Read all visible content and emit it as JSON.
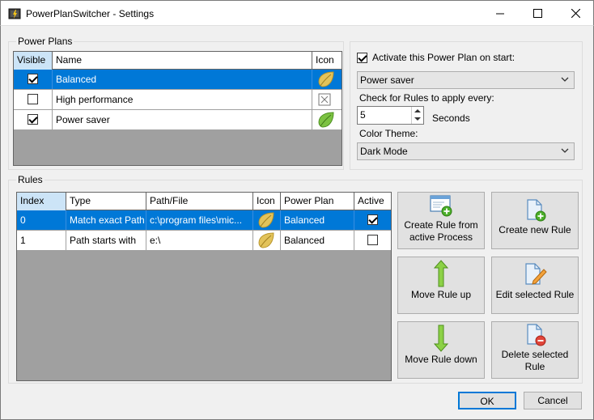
{
  "window": {
    "title": "PowerPlanSwitcher - Settings"
  },
  "power_plans": {
    "group_title": "Power Plans",
    "columns": [
      "Visible",
      "Name",
      "Icon"
    ],
    "rows": [
      {
        "visible": true,
        "name": "Balanced",
        "icon": "leaf-gold-icon",
        "selected": true
      },
      {
        "visible": false,
        "name": "High performance",
        "icon": "box-x-icon",
        "selected": false
      },
      {
        "visible": true,
        "name": "Power saver",
        "icon": "leaf-green-icon",
        "selected": false
      }
    ]
  },
  "plan_settings": {
    "activate_label": "Activate this Power Plan on start:",
    "activate_checked": true,
    "plan_select": "Power saver",
    "interval_label": "Check for Rules to apply every:",
    "interval_value": "5",
    "interval_unit": "Seconds",
    "theme_label": "Color Theme:",
    "theme_select": "Dark Mode"
  },
  "rules": {
    "group_title": "Rules",
    "columns": [
      "Index",
      "Type",
      "Path/File",
      "Icon",
      "Power Plan",
      "Active"
    ],
    "rows": [
      {
        "index": "0",
        "type": "Match exact Path",
        "path": "c:\\program files\\mic...",
        "icon": "leaf-gold-icon",
        "plan": "Balanced",
        "active": true,
        "selected": true
      },
      {
        "index": "1",
        "type": "Path starts with",
        "path": "e:\\",
        "icon": "leaf-gold-icon",
        "plan": "Balanced",
        "active": false,
        "selected": false
      }
    ]
  },
  "rule_buttons": {
    "create_from_process": "Create Rule from active Process",
    "create_new": "Create new Rule",
    "move_up": "Move Rule up",
    "edit_selected": "Edit selected Rule",
    "move_down": "Move Rule down",
    "delete_selected": "Delete selected Rule"
  },
  "dialog_buttons": {
    "ok": "OK",
    "cancel": "Cancel"
  },
  "colors": {
    "selection": "#0078d7",
    "grid_empty": "#a0a0a0",
    "window_bg": "#f0f0f0",
    "accent_green": "#7cc242",
    "leaf_gold": "#e3c35a"
  }
}
